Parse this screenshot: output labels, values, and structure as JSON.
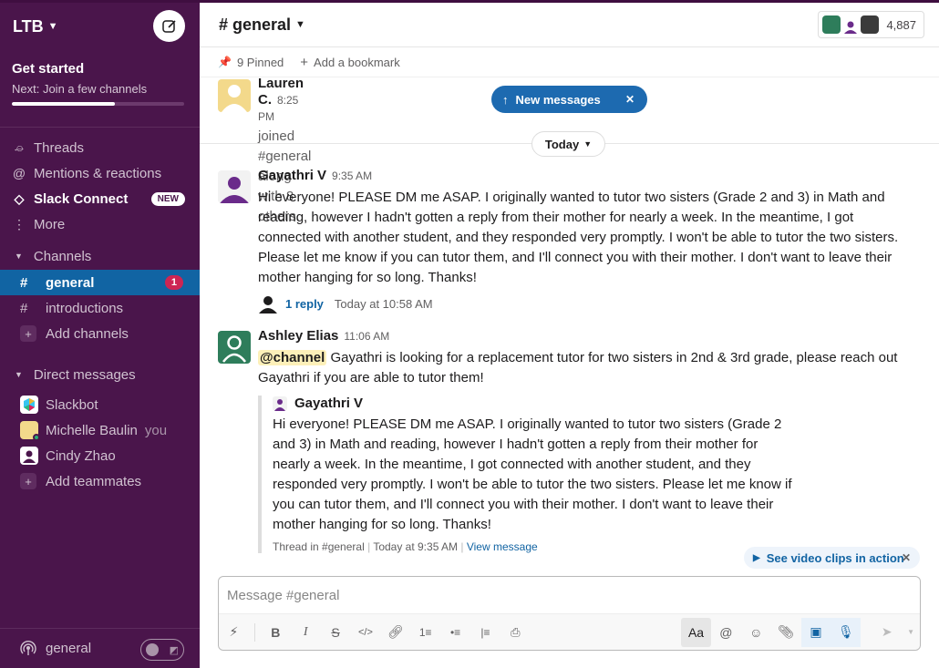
{
  "sidebar": {
    "workspace": "LTB",
    "get_started": {
      "title": "Get started",
      "subtitle": "Next: Join a few channels",
      "progress": 0.6
    },
    "nav": [
      {
        "label": "Threads",
        "icon": "threads-icon"
      },
      {
        "label": "Mentions & reactions",
        "icon": "at-icon"
      },
      {
        "label": "Slack Connect",
        "icon": "slack-connect-icon",
        "badge": "NEW"
      },
      {
        "label": "More",
        "icon": "more-icon"
      }
    ],
    "channels_heading": "Channels",
    "channels": [
      {
        "name": "general",
        "unread": "1",
        "active": true
      },
      {
        "name": "introductions"
      }
    ],
    "add_channels": "Add channels",
    "dm_heading": "Direct messages",
    "dms": [
      {
        "name": "Slackbot"
      },
      {
        "name": "Michelle Baulin",
        "suffix": "you"
      },
      {
        "name": "Cindy Zhao"
      }
    ],
    "add_teammates": "Add teammates",
    "footer": {
      "label": "general"
    }
  },
  "header": {
    "channel_title": "# general",
    "member_count": "4,887"
  },
  "bookmarks": {
    "pinned": "9 Pinned",
    "add": "Add a bookmark"
  },
  "messages": {
    "new_messages": "New messages",
    "date_divider": "Today",
    "first": {
      "user": "Lauren C.",
      "time": "8:25 PM",
      "text": "joined #general along with 8 others."
    },
    "second": {
      "user": "Gayathri V",
      "time": "9:35 AM",
      "lines": [
        "Hi everyone! PLEASE DM me ASAP. I originally wanted to tutor two sisters (Grade 2 and 3) in Math and",
        "reading, however I hadn't gotten a reply from their mother for nearly a week. In the meantime, I got",
        "connected with another student, and they responded very promptly. I won't be able to tutor the two sisters.",
        "Please let me know if you can tutor them, and I'll connect you with their mother. I don't want to leave their",
        "mother hanging for so long. Thanks!"
      ],
      "reply_count": "1 reply",
      "reply_time": "Today at 10:58 AM"
    },
    "third": {
      "user": "Ashley Elias",
      "time": "11:06 AM",
      "mention": "@channel",
      "line1": " Gayathri is looking for a replacement tutor for two sisters in 2nd & 3rd grade, please reach out",
      "line2": "Gayathri if you are able to tutor them!",
      "quote": {
        "user": "Gayathri V",
        "lines": [
          "Hi everyone! PLEASE DM me ASAP. I originally wanted to tutor two sisters (Grade 2",
          "and 3) in Math and reading, however I hadn't gotten a reply from their mother for",
          "nearly a week. In the meantime, I got connected with another student, and they",
          "responded very promptly. I won't be able to tutor the two sisters. Please let me know if",
          "you can tutor them, and I'll connect you with their mother. I don't want to leave their",
          "mother hanging for so long. Thanks!"
        ],
        "thread": "Thread in #general",
        "time": "Today at 9:35 AM",
        "view": "View message"
      }
    },
    "video_pill": "See video clips in action"
  },
  "composer": {
    "placeholder": "Message #general",
    "format_label": "Aa"
  },
  "colors": {
    "sidebar": "#4a154b",
    "active_channel": "#1164a3",
    "link": "#1264a3",
    "unread_badge": "#cd2553"
  }
}
